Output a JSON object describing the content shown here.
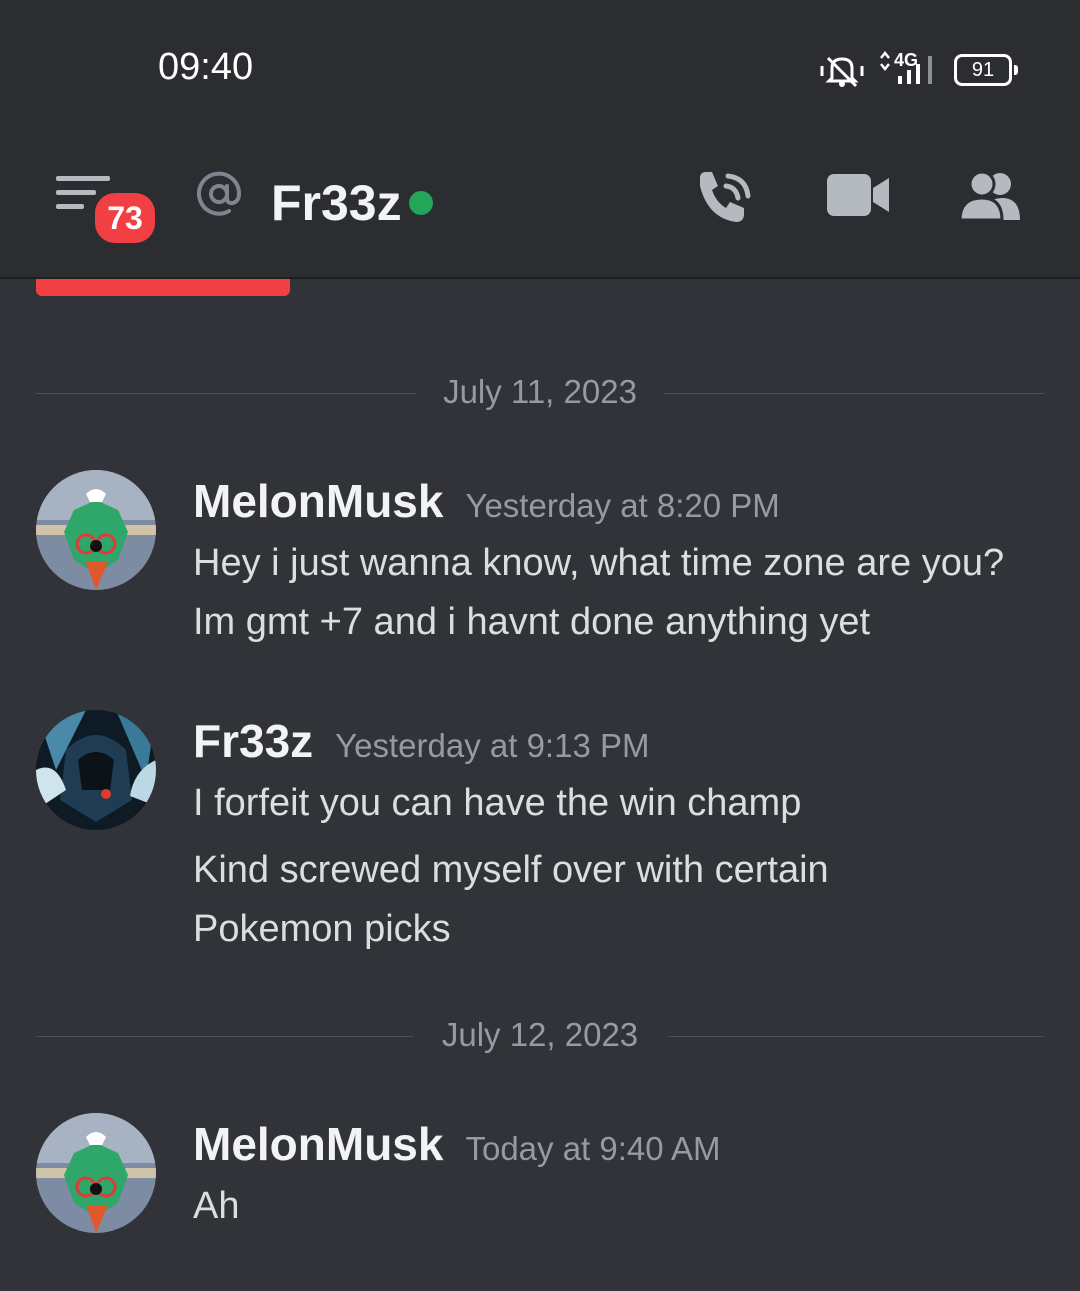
{
  "status_bar": {
    "time": "09:40",
    "network": "4G",
    "battery": "91"
  },
  "header": {
    "unread_count": "73",
    "channel_name": "Fr33z"
  },
  "dividers": [
    "July 11, 2023",
    "July 12, 2023"
  ],
  "messages": [
    {
      "username": "MelonMusk",
      "timestamp": "Yesterday at 8:20 PM",
      "lines": [
        "Hey i just wanna know, what time zone are you?",
        "Im gmt +7 and i havnt done anything yet"
      ]
    },
    {
      "username": "Fr33z",
      "timestamp": "Yesterday at 9:13 PM",
      "lines": [
        "I forfeit you can have the win champ",
        "Kind screwed myself over with certain",
        "Pokemon picks"
      ]
    },
    {
      "username": "MelonMusk",
      "timestamp": "Today at 9:40 AM",
      "lines": [
        "Ah"
      ]
    }
  ],
  "colors": {
    "background": "#313338",
    "header": "#2b2d31",
    "badge": "#f23f43",
    "online": "#23a55a"
  }
}
